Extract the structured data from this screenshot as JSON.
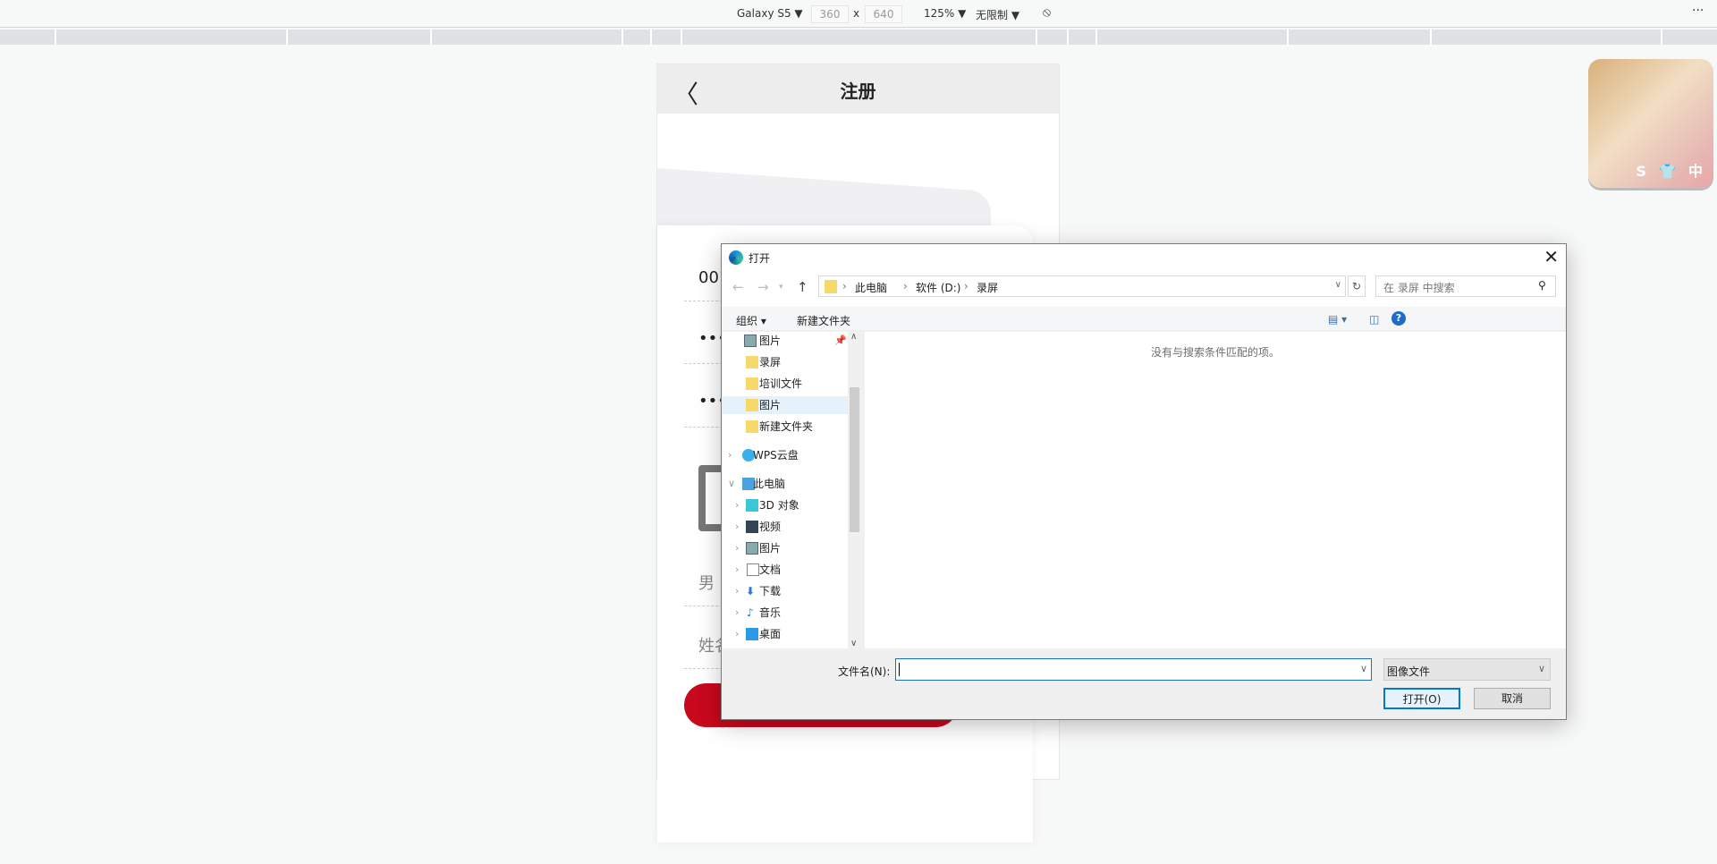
{
  "devtools": {
    "device": "Galaxy S5 ▼",
    "width": "360",
    "x": "x",
    "height": "640",
    "zoom": "125% ▼",
    "throttle": "无限制 ▼",
    "more": "···"
  },
  "phone": {
    "back": "〈",
    "title": "注册",
    "fields": {
      "account": "001",
      "password": "•••••",
      "confirm": "•••••",
      "gender": "男",
      "name": "姓名"
    }
  },
  "avatar": {
    "tags": "S 👕 中"
  },
  "dialog": {
    "title": "打开",
    "close": "✕",
    "breadcrumb": [
      "此电脑",
      "软件 (D:)",
      "录屏"
    ],
    "search_placeholder": "在 录屏 中搜索",
    "organize": "组织 ▾",
    "new_folder": "新建文件夹",
    "nav_items": [
      {
        "label": "图片",
        "icon": "pictures-icon"
      },
      {
        "label": "录屏",
        "icon": "folder-icon"
      },
      {
        "label": "培训文件",
        "icon": "folder-icon"
      },
      {
        "label": "图片",
        "icon": "folder-icon",
        "selected": true
      },
      {
        "label": "新建文件夹",
        "icon": "folder-icon"
      },
      {
        "label": "WPS云盘",
        "icon": "cloud-icon"
      },
      {
        "label": "此电脑",
        "icon": "computer-icon"
      },
      {
        "label": "3D 对象",
        "icon": "cube-icon"
      },
      {
        "label": "视频",
        "icon": "video-icon"
      },
      {
        "label": "图片",
        "icon": "pictures-icon"
      },
      {
        "label": "文档",
        "icon": "document-icon"
      },
      {
        "label": "下载",
        "icon": "download-icon"
      },
      {
        "label": "音乐",
        "icon": "music-icon"
      },
      {
        "label": "桌面",
        "icon": "desktop-icon"
      }
    ],
    "empty_message": "没有与搜索条件匹配的项。",
    "filename_label": "文件名(N):",
    "filename_value": "",
    "filetype": "图像文件",
    "open": "打开(O)",
    "cancel": "取消"
  },
  "colors": {
    "accent": "#0078d7",
    "brand_red": "#c8081c"
  }
}
